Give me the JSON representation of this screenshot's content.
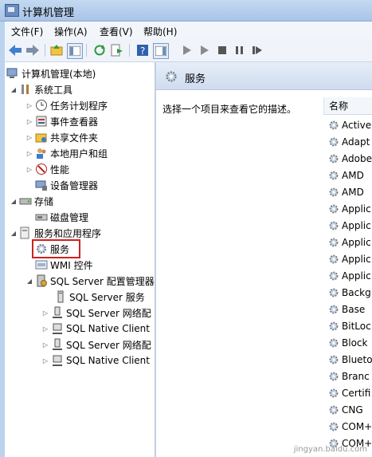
{
  "window": {
    "title": "计算机管理"
  },
  "menu": [
    "文件(F)",
    "操作(A)",
    "查看(V)",
    "帮助(H)"
  ],
  "tree": [
    {
      "label": "计算机管理(本地)",
      "icon": "computer-icon"
    },
    {
      "label": "系统工具",
      "icon": "tools-icon"
    },
    {
      "label": "任务计划程序",
      "icon": "clock-icon"
    },
    {
      "label": "事件查看器",
      "icon": "event-viewer-icon"
    },
    {
      "label": "共享文件夹",
      "icon": "shared-folder-icon"
    },
    {
      "label": "本地用户和组",
      "icon": "users-icon"
    },
    {
      "label": "性能",
      "icon": "performance-icon"
    },
    {
      "label": "设备管理器",
      "icon": "device-manager-icon"
    },
    {
      "label": "存储",
      "icon": "storage-icon"
    },
    {
      "label": "磁盘管理",
      "icon": "disk-icon"
    },
    {
      "label": "服务和应用程序",
      "icon": "services-apps-icon"
    },
    {
      "label": "服务",
      "icon": "gear-icon"
    },
    {
      "label": "WMI 控件",
      "icon": "wmi-icon"
    },
    {
      "label": "SQL Server 配置管理器",
      "icon": "sql-config-icon"
    },
    {
      "label": "SQL Server 服务",
      "icon": "server-icon"
    },
    {
      "label": "SQL Server 网络配",
      "icon": "network-icon"
    },
    {
      "label": "SQL Native Client",
      "icon": "network-icon"
    },
    {
      "label": "SQL Server 网络配",
      "icon": "network-icon"
    },
    {
      "label": "SQL Native Client",
      "icon": "network-icon"
    }
  ],
  "right_pane": {
    "title": "服务",
    "description": "选择一个项目来查看它的描述。",
    "column_name": "名称",
    "services": [
      "Active",
      "Adapt",
      "Adobe",
      "AMD",
      "AMD",
      "Applic",
      "Applic",
      "Applic",
      "Applic",
      "Applic",
      "Backg",
      "Base",
      "BitLoc",
      "Block",
      "Blueto",
      "Branc",
      "Certifi",
      "CNG",
      "COM+",
      "COM+"
    ]
  },
  "colors": {
    "selection_border": "#d0201e",
    "title_bar": "#b7cdea"
  },
  "watermark": "jingyan.baidu.com"
}
